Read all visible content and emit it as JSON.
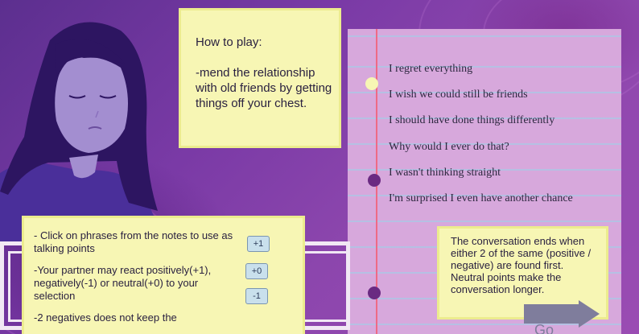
{
  "howto": {
    "title": "How to play:",
    "body": "-mend the relationship with old friends by getting things off your chest."
  },
  "phrases": [
    "I regret everything",
    "I wish we could still be friends",
    "I should have done things differently",
    "Why would I ever do that?",
    "I wasn't thinking straight",
    "I'm surprised I even have another chance"
  ],
  "rules": {
    "click": "- Click on phrases from the notes to use as talking points",
    "react": "-Your partner may react positively(+1), negatively(-1) or neutral(+0) to your selection",
    "negatives": "-2 negatives does not keep the"
  },
  "badges": {
    "plus": "+1",
    "zero": "+0",
    "minus": "-1"
  },
  "ends": "The conversation ends when either 2 of the same (positive / negative) are found first. Neutral points make the conversation longer.",
  "go_label": "Go",
  "colors": {
    "sticky": "#f7f6b4",
    "notes": "#d7a8dc",
    "margin": "#ee6a86",
    "dot_light": "#f7f6b4",
    "dot_dark": "#6a2a82"
  }
}
